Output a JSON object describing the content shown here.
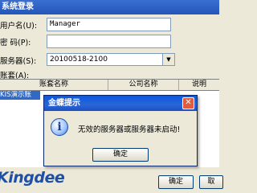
{
  "window": {
    "title": "系统登录"
  },
  "form": {
    "user_label": "用户名(U):",
    "user_value": "Manager",
    "password_label": "密    码(P):",
    "password_value": "",
    "server_label": "服务器(S):",
    "server_value": "20100518-2100",
    "account_label": "账套(A):"
  },
  "grid": {
    "columns": [
      "账套名称",
      "公司名称",
      "说明"
    ],
    "selected_row_text": "KIS演示账"
  },
  "footer": {
    "logo_text": "Kingdee",
    "ok_label": "确定",
    "cancel_label": "取"
  },
  "dialog": {
    "title": "金蝶提示",
    "message": "无效的服务器或服务器未启动!",
    "ok_label": "确定",
    "close_glyph": "✕",
    "icon_glyph": "i",
    "icon": "info-icon"
  },
  "icons": {
    "dropdown": "▼"
  }
}
